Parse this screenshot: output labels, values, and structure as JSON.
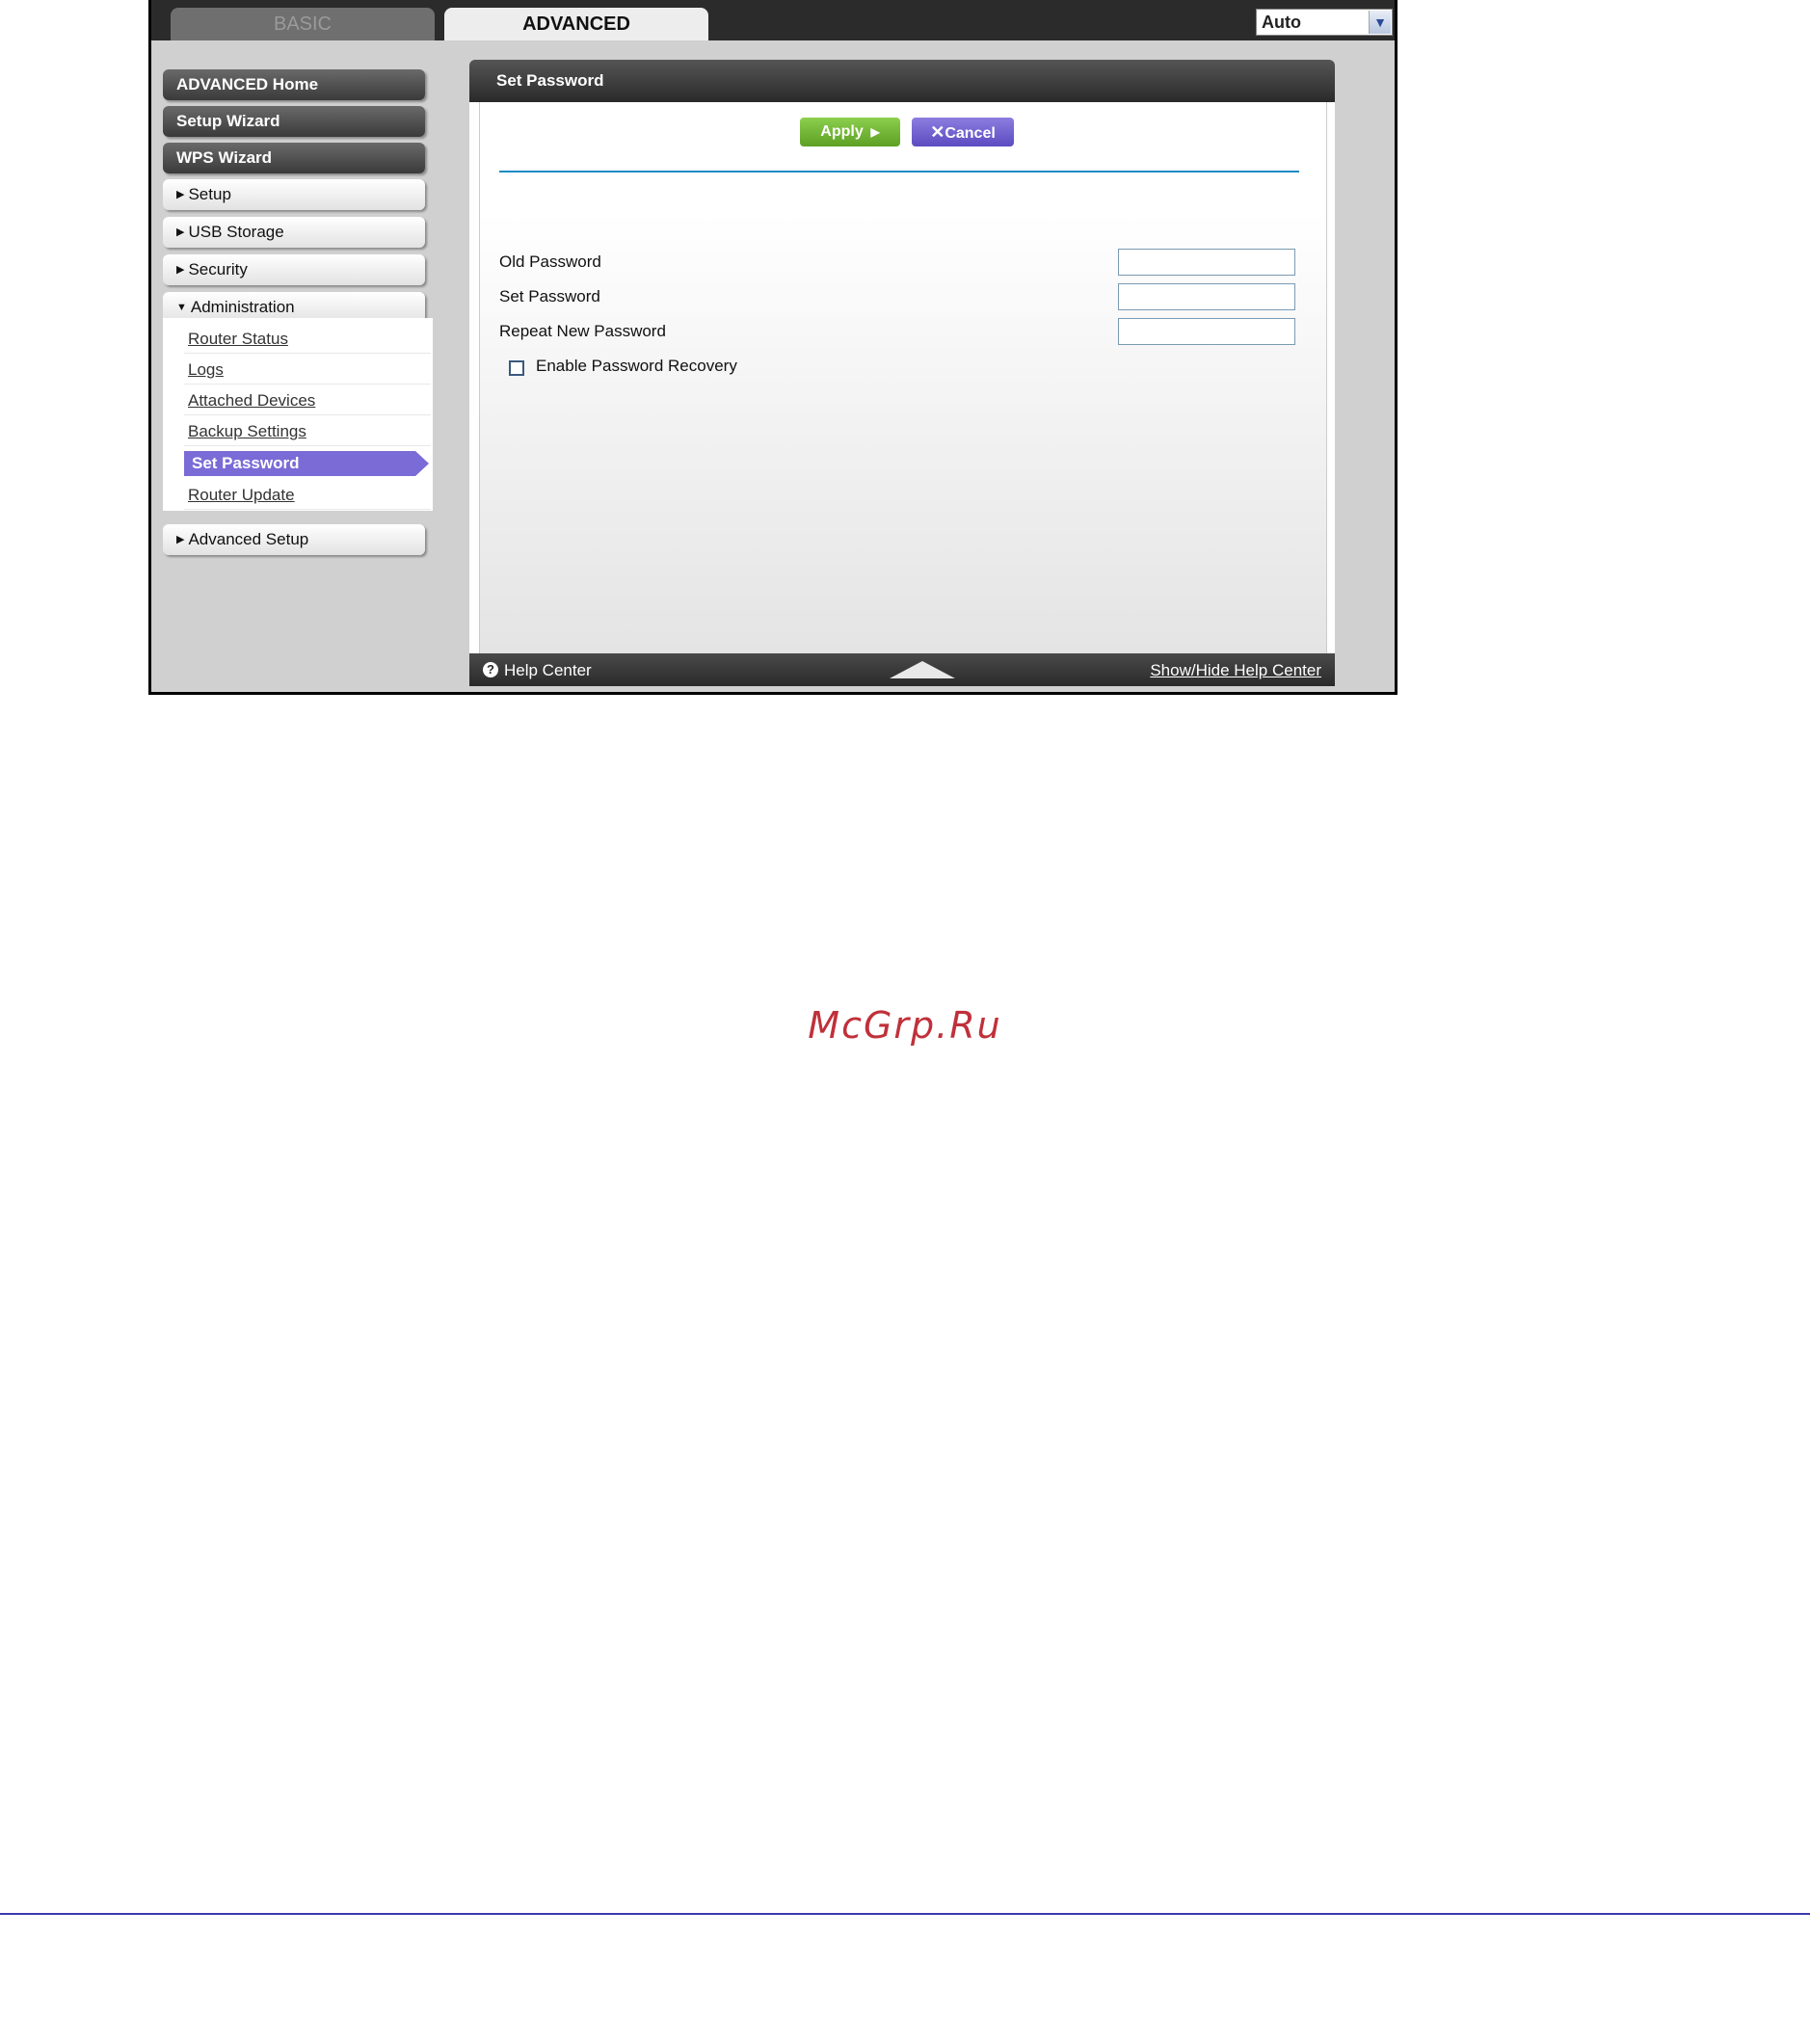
{
  "tabs": {
    "basic": "BASIC",
    "advanced": "ADVANCED"
  },
  "language": {
    "selected": "Auto"
  },
  "sidebar": {
    "main_items": [
      "ADVANCED Home",
      "Setup Wizard",
      "WPS Wizard"
    ],
    "sections": [
      "Setup",
      "USB Storage",
      "Security",
      "Administration",
      "Advanced Setup"
    ],
    "admin_items": [
      "Router Status",
      "Logs",
      "Attached Devices",
      "Backup Settings",
      "Set Password",
      "Router Update"
    ]
  },
  "panel": {
    "title": "Set Password",
    "apply_label": "Apply",
    "cancel_label": "Cancel",
    "fields": {
      "old": "Old Password",
      "set": "Set Password",
      "repeat": "Repeat New Password"
    },
    "recovery_label": "Enable Password Recovery"
  },
  "help": {
    "label": "Help Center",
    "toggle_link": "Show/Hide Help Center"
  },
  "watermark": "McGrp.Ru"
}
